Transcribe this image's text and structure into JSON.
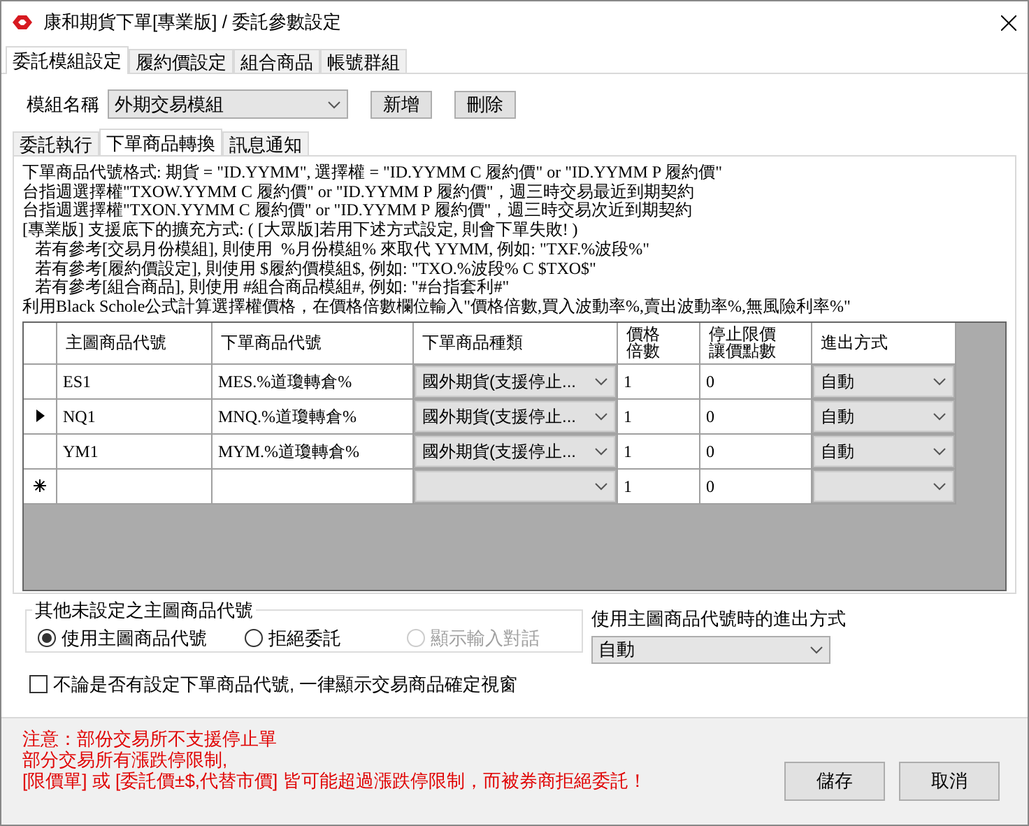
{
  "window": {
    "title": "康和期貨下單[專業版] / 委託參數設定"
  },
  "tabs": [
    {
      "label": "委託模組設定",
      "selected": true
    },
    {
      "label": "履約價設定",
      "selected": false
    },
    {
      "label": "組合商品",
      "selected": false
    },
    {
      "label": "帳號群組",
      "selected": false
    }
  ],
  "module": {
    "label": "模組名稱",
    "value": "外期交易模組",
    "buttons": [
      "新增",
      "刪除"
    ]
  },
  "subtabs": [
    {
      "label": "委託執行",
      "selected": false
    },
    {
      "label": "下單商品轉換",
      "selected": true
    },
    {
      "label": "訊息通知",
      "selected": false
    }
  ],
  "help_lines": [
    "下單商品代號格式: 期貨 = \"ID.YYMM\", 選擇權 = \"ID.YYMM C 履約價\" or \"ID.YYMM P 履約價\"",
    "台指週選擇權\"TXOW.YYMM C 履約價\" or \"ID.YYMM P 履約價\"，週三時交易最近到期契約",
    "台指週選擇權\"TXON.YYMM C 履約價\" or \"ID.YYMM P 履約價\"，週三時交易次近到期契約",
    "[專業版] 支援底下的擴充方式: ( [大眾版]若用下述方式設定, 則會下單失敗! )",
    "   若有參考[交易月份模組], 則使用  %月份模組% 來取代 YYMM, 例如: \"TXF.%波段%\"",
    "   若有參考[履約價設定], 則使用 $履約價模組$, 例如: \"TXO.%波段% C $TXO$\"",
    "   若有參考[組合商品], 則使用 #組合商品模組#, 例如: \"#台指套利#\"",
    "利用Black Schole公式計算選擇權價格，在價格倍數欄位輸入\"價格倍數,買入波動率%,賣出波動率%,無風險利率%\""
  ],
  "table": {
    "columns": [
      "主圖商品代號",
      "下單商品代號",
      "下單商品種類",
      [
        "價格",
        "倍數"
      ],
      [
        "停止限價",
        "讓價點數"
      ],
      "進出方式"
    ],
    "rows": [
      {
        "kind": "plain",
        "cells": [
          "ES1",
          "MES.%道瓊轉倉%",
          "國外期貨(支援停止...",
          "1",
          "0",
          "自動"
        ]
      },
      {
        "kind": "current",
        "cells": [
          "NQ1",
          "MNQ.%道瓊轉倉%",
          "國外期貨(支援停止...",
          "1",
          "0",
          "自動"
        ]
      },
      {
        "kind": "plain",
        "cells": [
          "YM1",
          "MYM.%道瓊轉倉%",
          "國外期貨(支援停止...",
          "1",
          "0",
          "自動"
        ]
      },
      {
        "kind": "new",
        "cells": [
          "",
          "",
          "",
          "1",
          "0",
          ""
        ]
      }
    ]
  },
  "fallback": {
    "title": "其他未設定之主圖商品代號",
    "options": [
      {
        "label": "使用主圖商品代號",
        "selected": true,
        "disabled": false
      },
      {
        "label": "拒絕委託",
        "selected": false,
        "disabled": false
      },
      {
        "label": "顯示輸入對話",
        "selected": false,
        "disabled": true
      }
    ]
  },
  "entry_mode": {
    "label": "使用主圖商品代號時的進出方式",
    "value": "自動"
  },
  "always_confirm": {
    "label": "不論是否有設定下單商品代號, 一律顯示交易商品確定視窗",
    "checked": false
  },
  "notes": [
    "注意：部份交易所不支援停止單",
    "部分交易所有漲跌停限制,",
    "[限價單] 或 [委託價±$,代替市價] 皆可能超過漲跌停限制，而被券商拒絕委託！"
  ],
  "buttons": [
    "儲存",
    "取消"
  ]
}
